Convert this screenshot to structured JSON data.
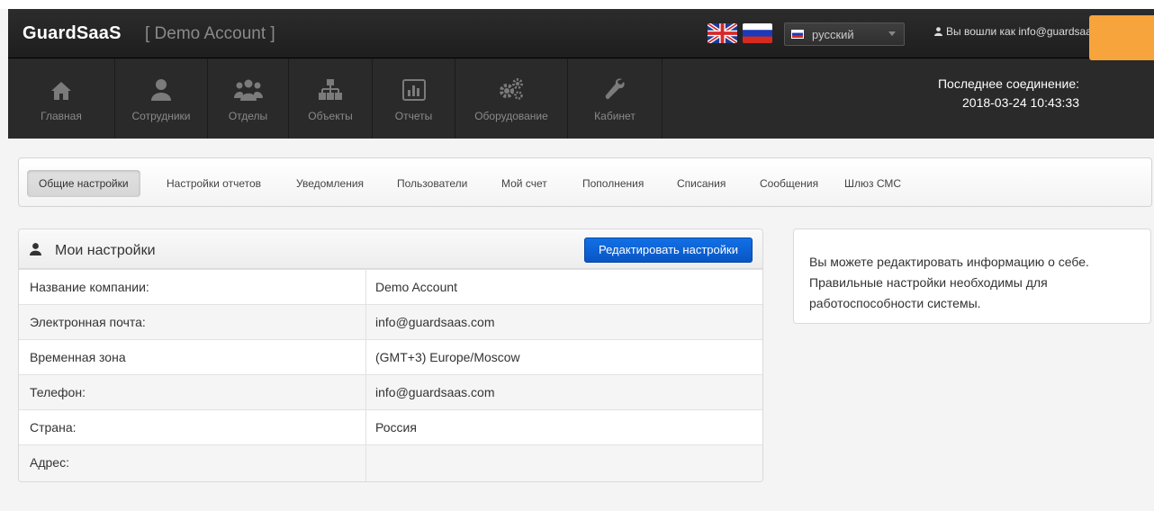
{
  "header": {
    "brand": "GuardSaaS",
    "account_label": "[ Demo Account ]",
    "language": {
      "selected": "русский"
    },
    "user_text": "Вы вошли как info@guardsaas.com"
  },
  "nav": {
    "items": [
      {
        "label": "Главная",
        "icon": "home-icon"
      },
      {
        "label": "Сотрудники",
        "icon": "user-icon"
      },
      {
        "label": "Отделы",
        "icon": "group-icon"
      },
      {
        "label": "Объекты",
        "icon": "sitemap-icon"
      },
      {
        "label": "Отчеты",
        "icon": "chart-icon"
      },
      {
        "label": "Оборудование",
        "icon": "gears-icon"
      },
      {
        "label": "Кабинет",
        "icon": "wrench-icon"
      }
    ],
    "last_connection_label": "Последнее соединение:",
    "last_connection_value": "2018-03-24 10:43:33"
  },
  "tabs": [
    {
      "label": "Общие настройки",
      "active": true
    },
    {
      "label": "Настройки отчетов"
    },
    {
      "label": "Уведомления"
    },
    {
      "label": "Пользователи"
    },
    {
      "label": "Мой счет"
    },
    {
      "label": "Пополнения"
    },
    {
      "label": "Списания"
    },
    {
      "label": "Сообщения"
    },
    {
      "label": "Шлюз СМС"
    }
  ],
  "settings": {
    "title": "Мои настройки",
    "edit_button": "Редактировать настройки",
    "rows": [
      {
        "label": "Название компании:",
        "value": "Demo Account"
      },
      {
        "label": "Электронная почта:",
        "value": "info@guardsaas.com"
      },
      {
        "label": "Временная зона",
        "value": "(GMT+3) Europe/Moscow"
      },
      {
        "label": "Телефон:",
        "value": "info@guardsaas.com"
      },
      {
        "label": "Страна:",
        "value": "Россия"
      },
      {
        "label": "Адрес:",
        "value": ""
      }
    ]
  },
  "info": {
    "text": "Вы можете редактировать информацию о себе. Правильные настройки необходимы для работоспособности системы."
  },
  "colors": {
    "header_bg": "#222222",
    "nav_bg": "#2a2a2a",
    "accent_orange": "#f7a43c",
    "primary_button": "#0a5fd6"
  }
}
